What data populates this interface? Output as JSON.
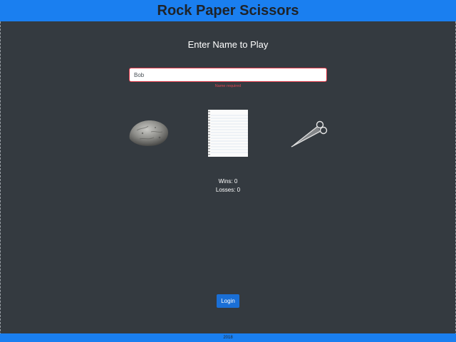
{
  "header": {
    "title": "Rock Paper Scissors"
  },
  "form": {
    "prompt": "Enter Name to Play",
    "name_value": "Bob",
    "error": "Name required"
  },
  "choices": [
    {
      "name": "rock",
      "icon": "rock-icon"
    },
    {
      "name": "paper",
      "icon": "paper-icon"
    },
    {
      "name": "scissors",
      "icon": "scissors-icon"
    }
  ],
  "stats": {
    "wins": "Wins: 0",
    "losses": "Losses: 0"
  },
  "login": {
    "label": "Login"
  },
  "footer": {
    "text": "2018"
  },
  "colors": {
    "background": "#343a40",
    "bar": "#1a7ff0",
    "button": "#1a6fd6",
    "error": "#dc3545"
  }
}
